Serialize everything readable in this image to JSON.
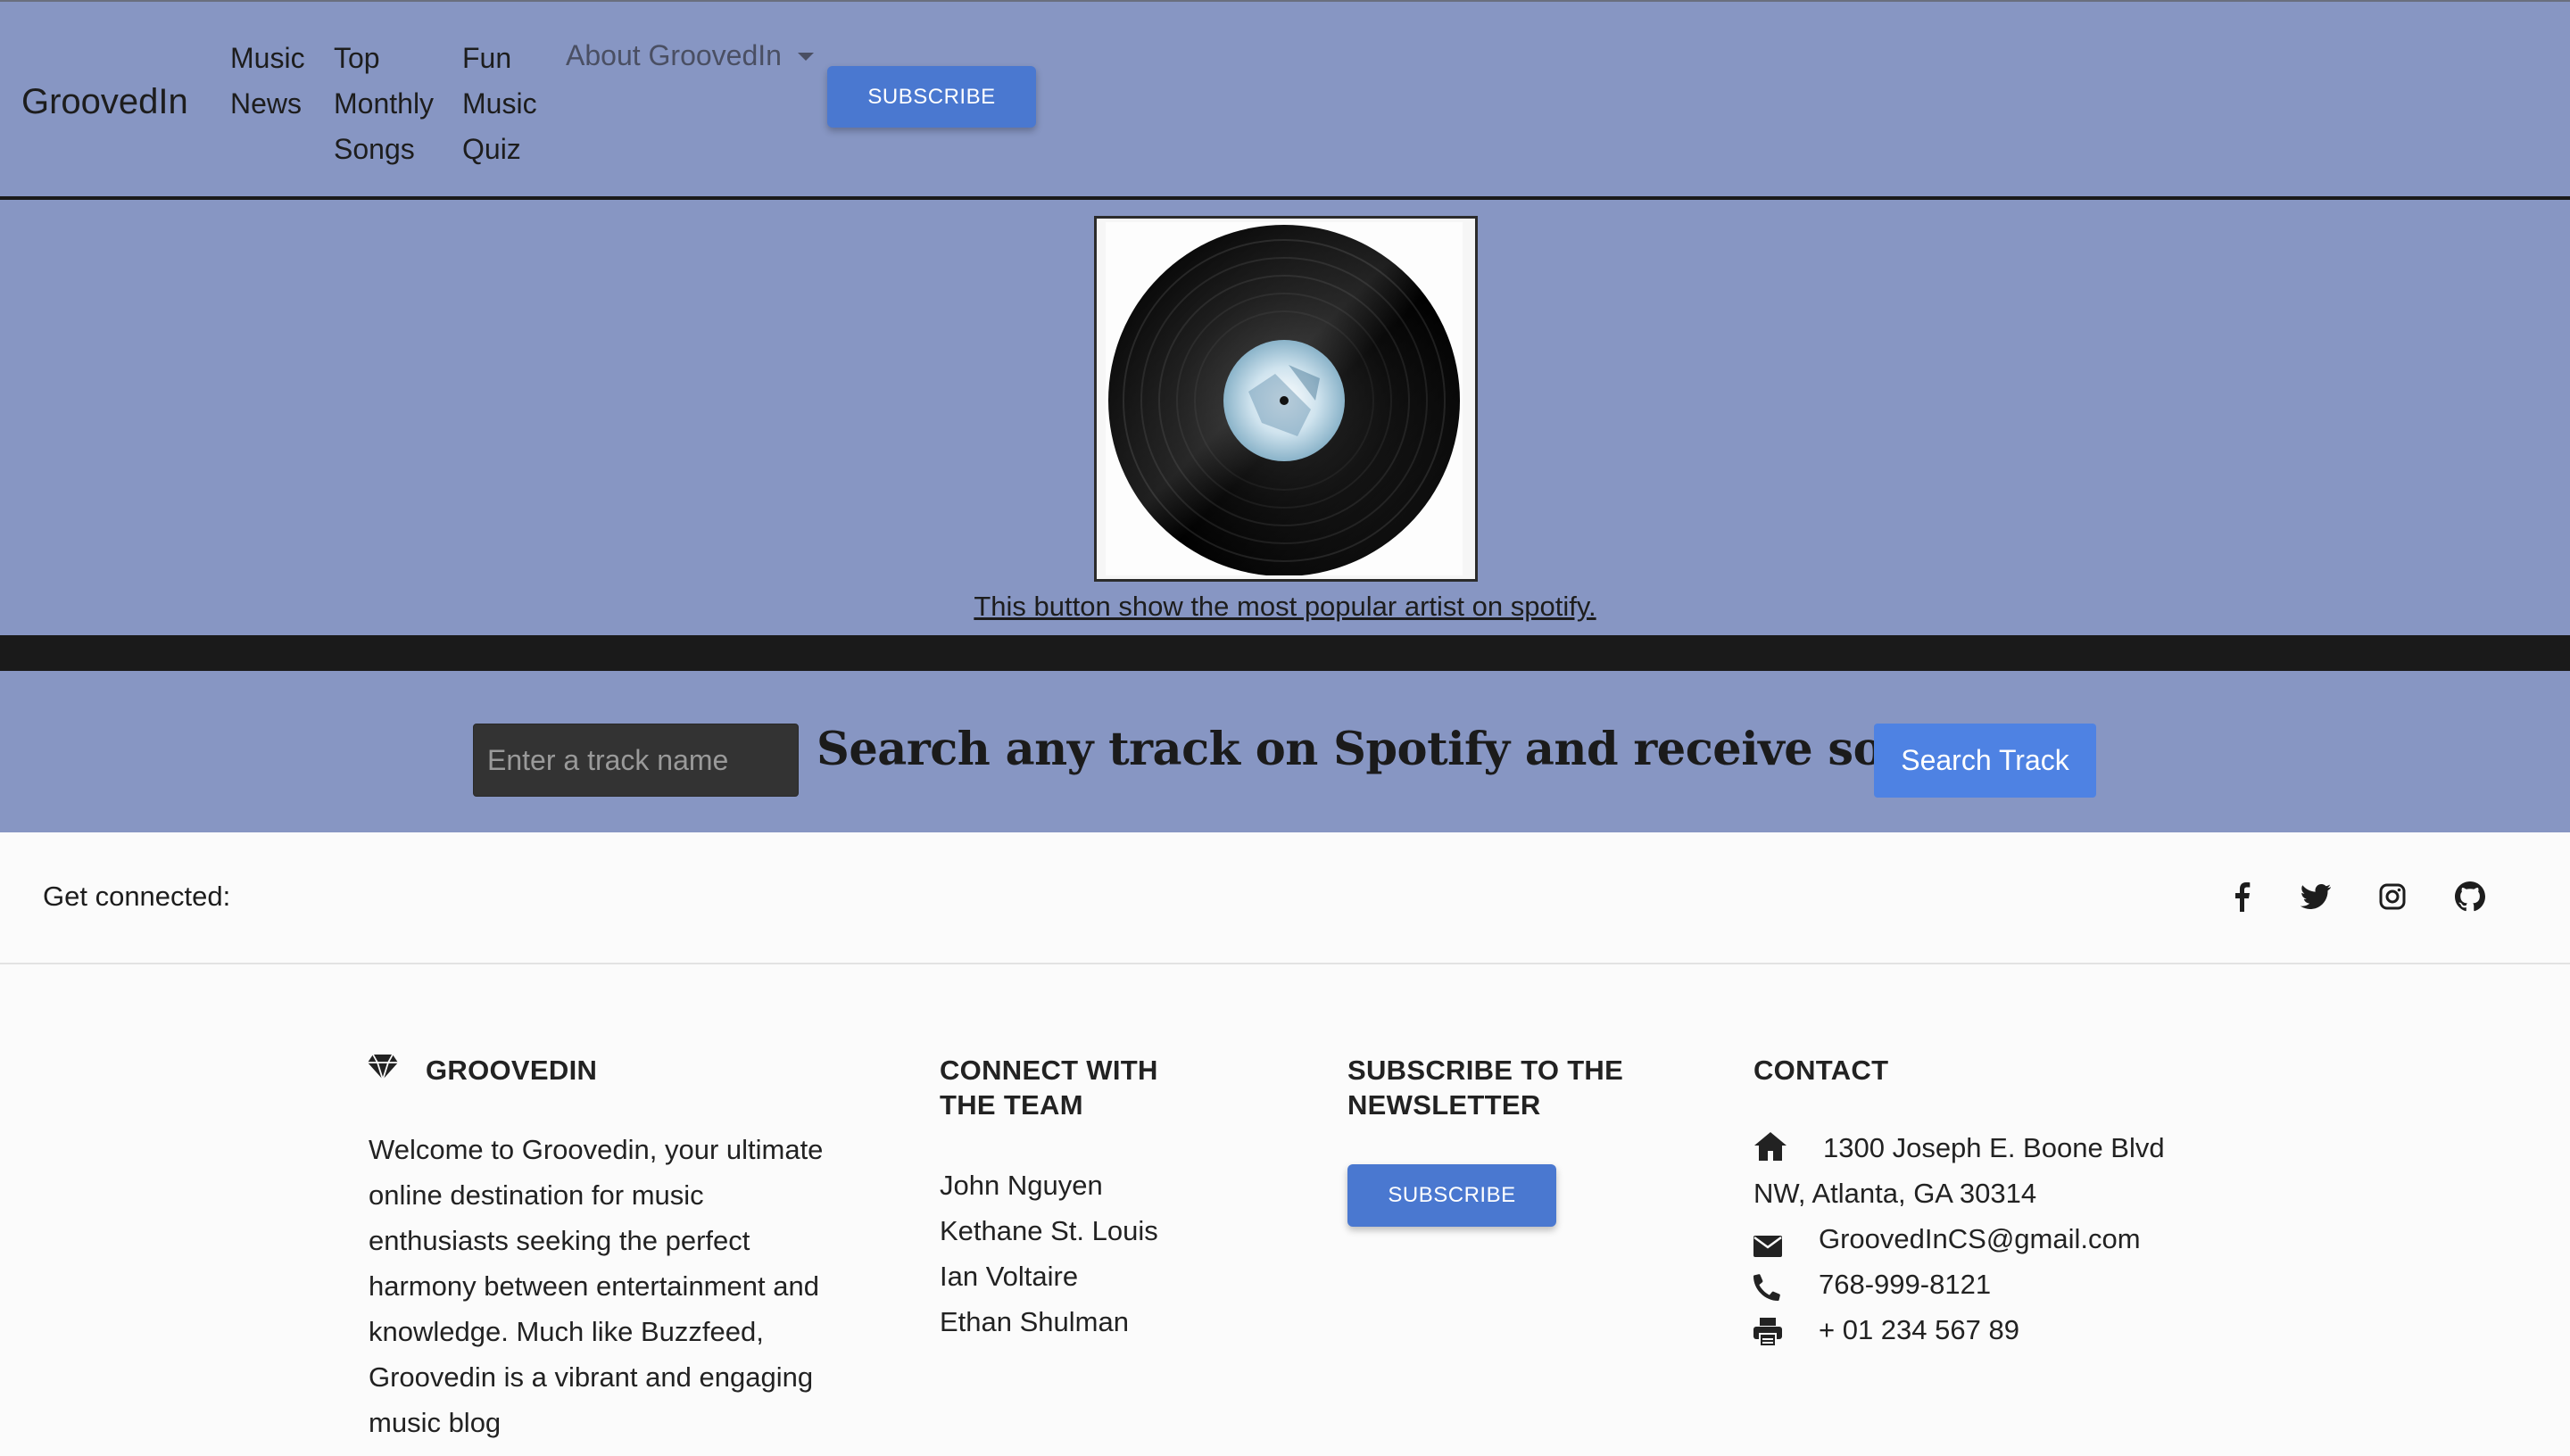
{
  "navbar": {
    "brand": "GroovedIn",
    "items": [
      {
        "lines": [
          "Music",
          "News"
        ]
      },
      {
        "lines": [
          "Top",
          "Monthly",
          "Songs"
        ]
      },
      {
        "lines": [
          "Fun",
          "Music",
          "Quiz"
        ]
      }
    ],
    "dropdown_label": "About GroovedIn",
    "subscribe_label": "SUBSCRIBE"
  },
  "hero": {
    "image": "vinyl-record-icon",
    "link_text": "This button show the most popular artist on spotify."
  },
  "search": {
    "placeholder": "Enter a track name",
    "heading": "Search any track on Spotify and receive song data!",
    "button_label": "Search Track"
  },
  "connect": {
    "label": "Get connected:",
    "icons": [
      "facebook-icon",
      "twitter-icon",
      "instagram-icon",
      "github-icon"
    ]
  },
  "footer": {
    "about": {
      "icon": "gem-icon",
      "title": "GROOVEDIN",
      "text": "Welcome to Groovedin, your ultimate online destination for music enthusiasts seeking the perfect harmony between entertainment and knowledge. Much like Buzzfeed, Groovedin is a vibrant and engaging music blog"
    },
    "team": {
      "title_line1": "CONNECT WITH",
      "title_line2": "THE TEAM",
      "members": [
        "John Nguyen",
        "Kethane St. Louis",
        "Ian Voltaire",
        "Ethan Shulman"
      ]
    },
    "newsletter": {
      "title_line1": "SUBSCRIBE TO THE",
      "title_line2": "NEWSLETTER",
      "button_label": "SUBSCRIBE"
    },
    "contact": {
      "title": "CONTACT",
      "address_line1": "1300 Joseph E. Boone Blvd",
      "address_line2": "NW, Atlanta, GA 30314",
      "email": "GroovedInCS@gmail.com",
      "phone": "768-999-8121",
      "fax": "+ 01 234 567 89"
    }
  },
  "colors": {
    "nav_bg": "#8796c3",
    "button_blue": "#4a78d0",
    "search_button": "#4e82e3",
    "dark_band": "#1a1a1a"
  }
}
